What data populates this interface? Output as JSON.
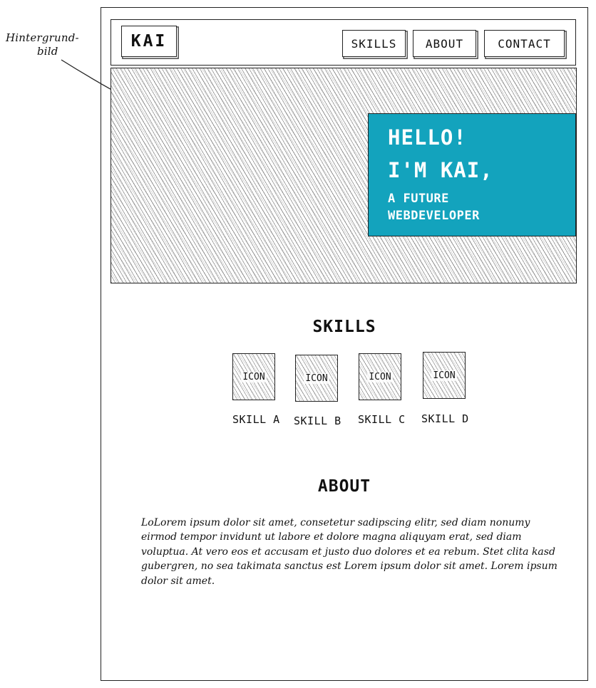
{
  "annotation": {
    "line1": "Hintergrund-",
    "line2": "bild"
  },
  "nav": {
    "logo": "KAI",
    "items": [
      {
        "label": "SKILLS"
      },
      {
        "label": "ABOUT"
      },
      {
        "label": "CONTACT"
      }
    ]
  },
  "hero": {
    "greeting": "HELLO!",
    "name": "I'M KAI,",
    "tagline_line1": "A FUTURE",
    "tagline_line2": "WEBDEVELOPER",
    "card_color": "#13a3bd"
  },
  "skills": {
    "heading": "SKILLS",
    "items": [
      {
        "icon_label": "ICON",
        "label": "SKILL A"
      },
      {
        "icon_label": "ICON",
        "label": "SKILL B"
      },
      {
        "icon_label": "ICON",
        "label": "SKILL C"
      },
      {
        "icon_label": "ICON",
        "label": "SKILL D"
      }
    ]
  },
  "about": {
    "heading": "ABOUT",
    "text": "LoLorem ipsum dolor sit amet, consetetur sadipscing elitr, sed diam nonumy eirmod tempor invidunt ut labore et dolore magna aliquyam erat, sed diam voluptua. At vero eos et accusam et justo duo dolores et ea rebum. Stet clita kasd gubergren, no sea takimata sanctus est Lorem ipsum dolor sit amet. Lorem ipsum dolor sit amet."
  }
}
